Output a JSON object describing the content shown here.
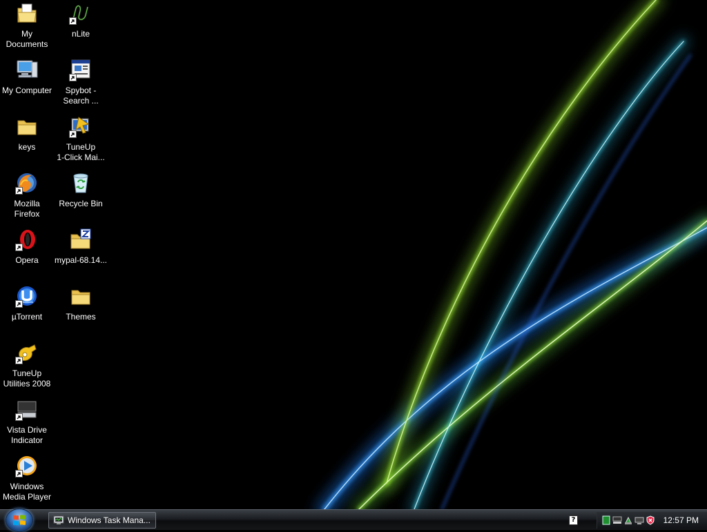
{
  "desktop": {
    "icons": [
      {
        "label": "My\nDocuments",
        "icon": "my-documents-icon"
      },
      {
        "label": "My Computer",
        "icon": "my-computer-icon"
      },
      {
        "label": "keys",
        "icon": "folder-icon"
      },
      {
        "label": "Mozilla\nFirefox",
        "icon": "firefox-icon"
      },
      {
        "label": "Opera",
        "icon": "opera-icon"
      },
      {
        "label": "µTorrent",
        "icon": "utorrent-icon"
      },
      {
        "label": "TuneUp\nUtilities 2008",
        "icon": "tuneup-utilities-icon"
      },
      {
        "label": "Vista Drive\nIndicator",
        "icon": "drive-indicator-icon"
      },
      {
        "label": "Windows\nMedia Player",
        "icon": "media-player-icon"
      },
      {
        "label": "nLite",
        "icon": "nlite-icon"
      },
      {
        "label": "Spybot -\nSearch ...",
        "icon": "spybot-icon"
      },
      {
        "label": "TuneUp\n1-Click Mai...",
        "icon": "tuneup-1click-icon"
      },
      {
        "label": "Recycle Bin",
        "icon": "recycle-bin-icon"
      },
      {
        "label": "mypal-68.14...",
        "icon": "zip-folder-icon"
      },
      {
        "label": "Themes",
        "icon": "folder-icon"
      }
    ]
  },
  "taskbar": {
    "task_button": "Windows Task Mana...",
    "help_icon": "?",
    "clock": "12:57 PM"
  },
  "colors": {
    "taskbar_dark": "#0b0c0e",
    "wallpaper_green": "#8fd12b",
    "wallpaper_cyan": "#3fd0e8",
    "wallpaper_blue": "#2a5fd8"
  }
}
